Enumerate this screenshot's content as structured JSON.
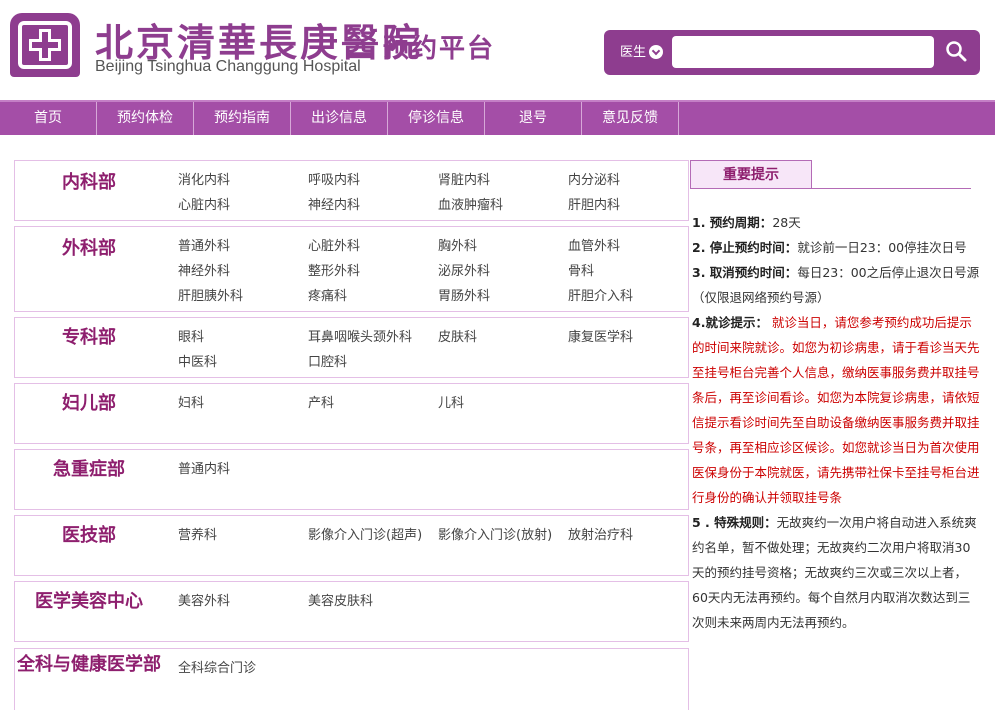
{
  "header": {
    "logo_cn": "北京清華長庚醫院",
    "logo_en": "Beijing Tsinghua Changgung Hospital",
    "platform_title": "预约平台",
    "search": {
      "type_label": "医生",
      "placeholder": ""
    }
  },
  "nav": [
    "首页",
    "预约体检",
    "预约指南",
    "出诊信息",
    "停诊信息",
    "退号",
    "意见反馈"
  ],
  "departments": [
    {
      "name": "内科部",
      "clinics": [
        "消化内科",
        "呼吸内科",
        "肾脏内科",
        "内分泌科",
        "心脏内科",
        "神经内科",
        "血液肿瘤科",
        "肝胆内科"
      ]
    },
    {
      "name": "外科部",
      "clinics": [
        "普通外科",
        "心脏外科",
        "胸外科",
        "血管外科",
        "神经外科",
        "整形外科",
        "泌尿外科",
        "骨科",
        "肝胆胰外科",
        "疼痛科",
        "胃肠外科",
        "肝胆介入科"
      ]
    },
    {
      "name": "专科部",
      "clinics": [
        "眼科",
        "耳鼻咽喉头颈外科",
        "皮肤科",
        "康复医学科",
        "中医科",
        "口腔科"
      ]
    },
    {
      "name": "妇儿部",
      "clinics": [
        "妇科",
        "产科",
        "儿科"
      ]
    },
    {
      "name": "急重症部",
      "clinics": [
        "普通内科"
      ]
    },
    {
      "name": "医技部",
      "clinics": [
        "营养科",
        "影像介入门诊(超声)",
        "影像介入门诊(放射)",
        "放射治疗科"
      ]
    },
    {
      "name": "医学美容中心",
      "clinics": [
        "美容外科",
        "美容皮肤科"
      ]
    },
    {
      "name": "全科与健康医学部",
      "clinics": [
        "全科综合门诊"
      ]
    }
  ],
  "notice": {
    "title": "重要提示",
    "items": [
      {
        "label": "1. 预约周期：",
        "text": "28天",
        "red": ""
      },
      {
        "label": "2. 停止预约时间：",
        "text": "就诊前一日23：00停挂次日号",
        "red": ""
      },
      {
        "label": "3. 取消预约时间：",
        "text": "每日23：00之后停止退次日号源（仅限退网络预约号源）",
        "red": ""
      },
      {
        "label": "4.就诊提示：",
        "text": "",
        "red": " 就诊当日，请您参考预约成功后提示的时间来院就诊。如您为初诊病患，请于看诊当天先至挂号柜台完善个人信息，缴纳医事服务费并取挂号条后，再至诊间看诊。如您为本院复诊病患，请依短信提示看诊时间先至自助设备缴纳医事服务费并取挂号条，再至相应诊区候诊。如您就诊当日为首次使用医保身份于本院就医，请先携带社保卡至挂号柜台进行身份的确认并领取挂号条"
      },
      {
        "label": "5 . 特殊规则：",
        "text": "无故爽约一次用户将自动进入系统爽约名单，暂不做处理；无故爽约二次用户将取消30天的预约挂号资格；无故爽约三次或三次以上者，60天内无法再预约。每个自然月内取消次数达到三次则未来两周内无法再预约。",
        "red": ""
      }
    ]
  },
  "colors": {
    "brand": "#8e3d8f",
    "nav": "#a44ea7",
    "dept_name": "#8e1f6e",
    "warning": "#cc0000"
  }
}
